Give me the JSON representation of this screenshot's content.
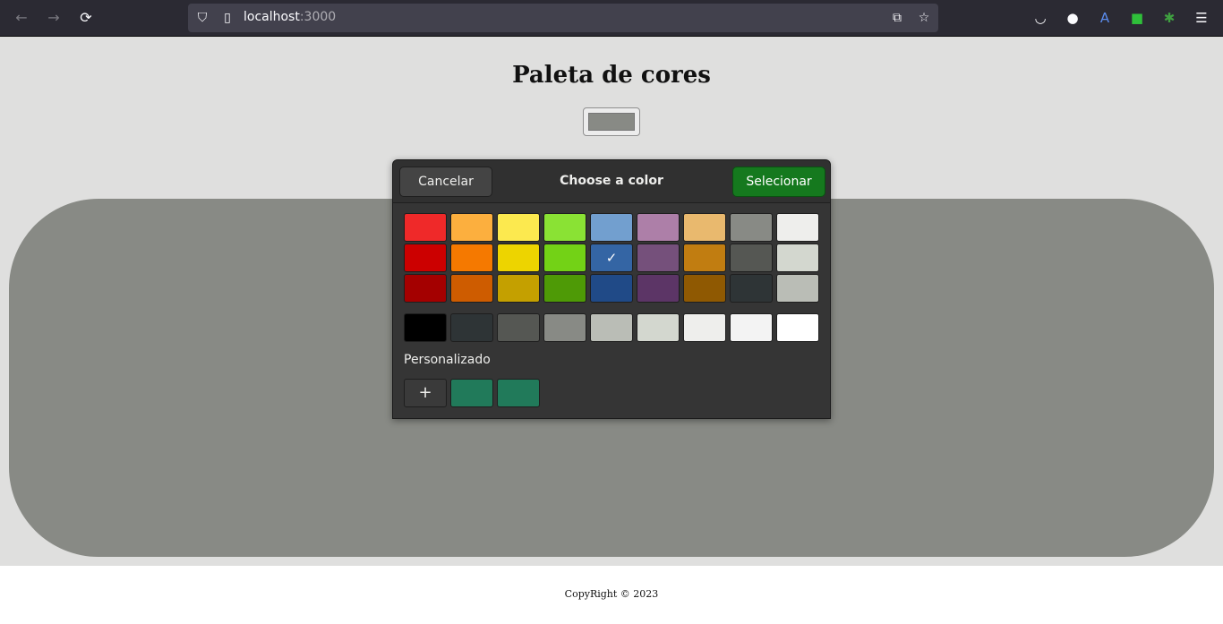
{
  "browser": {
    "url_host": "localhost",
    "url_port": ":3000"
  },
  "page": {
    "title": "Paleta de cores",
    "selected_color": "#888a85",
    "footer": "CopyRight © 2023"
  },
  "dialog": {
    "title": "Choose a color",
    "cancel_label": "Cancelar",
    "select_label": "Selecionar",
    "custom_label": "Personalizado",
    "add_icon": "+",
    "palette": [
      [
        "#ef2929",
        "#fcaf3e",
        "#fce94f",
        "#8ae234",
        "#729fcf",
        "#ad7fa8",
        "#e9b96e",
        "#888a85",
        "#eeeeec"
      ],
      [
        "#cc0000",
        "#f57900",
        "#edd400",
        "#73d216",
        "#3465a4",
        "#75507b",
        "#c17d11",
        "#555753",
        "#d3d7cf"
      ],
      [
        "#a40000",
        "#ce5c00",
        "#c4a000",
        "#4e9a06",
        "#204a87",
        "#5c3566",
        "#8f5902",
        "#2e3436",
        "#babdb6"
      ]
    ],
    "grays": [
      "#000000",
      "#2e3436",
      "#555753",
      "#888a85",
      "#babdb6",
      "#d3d7cf",
      "#eeeeec",
      "#f3f3f3",
      "#ffffff"
    ],
    "selected_cell": "1-4",
    "check_icon": "✓",
    "custom_colors": [
      "#217a5a",
      "#217a5a"
    ]
  }
}
